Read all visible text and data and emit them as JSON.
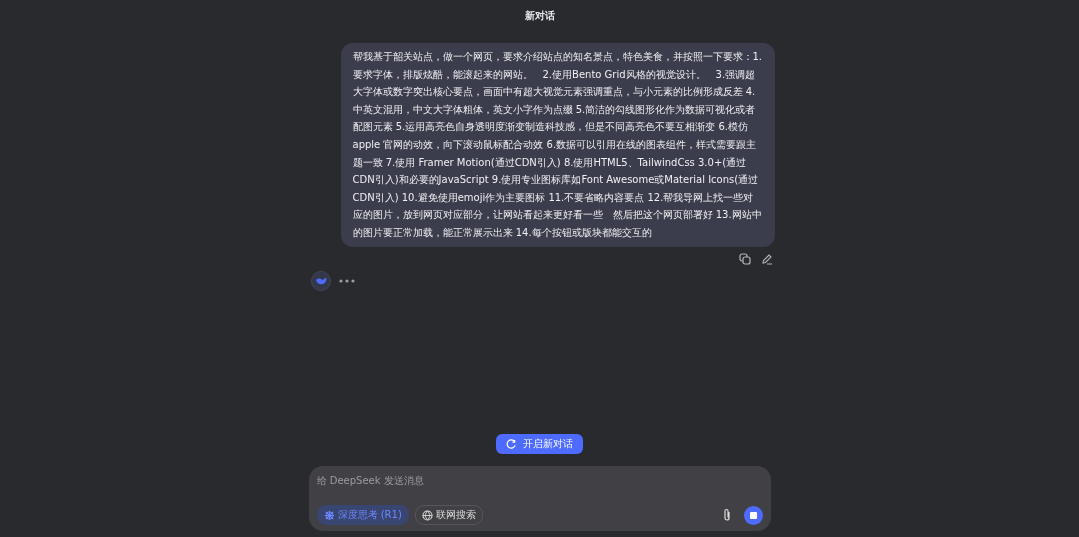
{
  "header": {
    "title": "新对话"
  },
  "user_message": {
    "text": "帮我基于韶关站点，做一个网页，要求介绍站点的知名景点，特色美食，并按照一下要求：1.要求字体，排版炫酷，能滚起来的网站。　2.使用Bento Grid风格的视觉设计。　3.强调超大字体或数字突出核心要点，画面中有超大视觉元素强调重点，与小元素的比例形成反差 4.中英文混用，中文大字体粗体，英文小字作为点缀 5.简洁的勾线图形化作为数据可视化或者配图元素 5.运用高亮色自身透明度渐变制造科技感，但是不同高亮色不要互相渐变 6.模仿 apple 官网的动效，向下滚动鼠标配合动效 6.数据可以引用在线的图表组件，样式需要跟主题一致 7.使用 Framer Motion(通过CDN引入) 8.使用HTML5、TailwindCss 3.0+(通过CDN引入)和必要的JavaScript 9.使用专业图标库如Font Awesome或Material Icons(通过CDN引入) 10.避免使用emoji作为主要图标 11.不要省略内容要点 12.帮我导网上找一些对应的图片，放到网页对应部分，让网站看起来更好看一些　然后把这个网页部署好 13.网站中的图片要正常加载，能正常展示出来 14.每个按钮或版块都能交互的"
  },
  "assistant": {
    "loading": true
  },
  "new_chat_button": {
    "label": "开启新对话"
  },
  "composer": {
    "placeholder": "给 DeepSeek 发送消息",
    "toggles": [
      {
        "label": "深度思考 (R1)",
        "selected": true,
        "kind": "think"
      },
      {
        "label": "联网搜索",
        "selected": false,
        "kind": "web"
      }
    ],
    "generating": true
  }
}
